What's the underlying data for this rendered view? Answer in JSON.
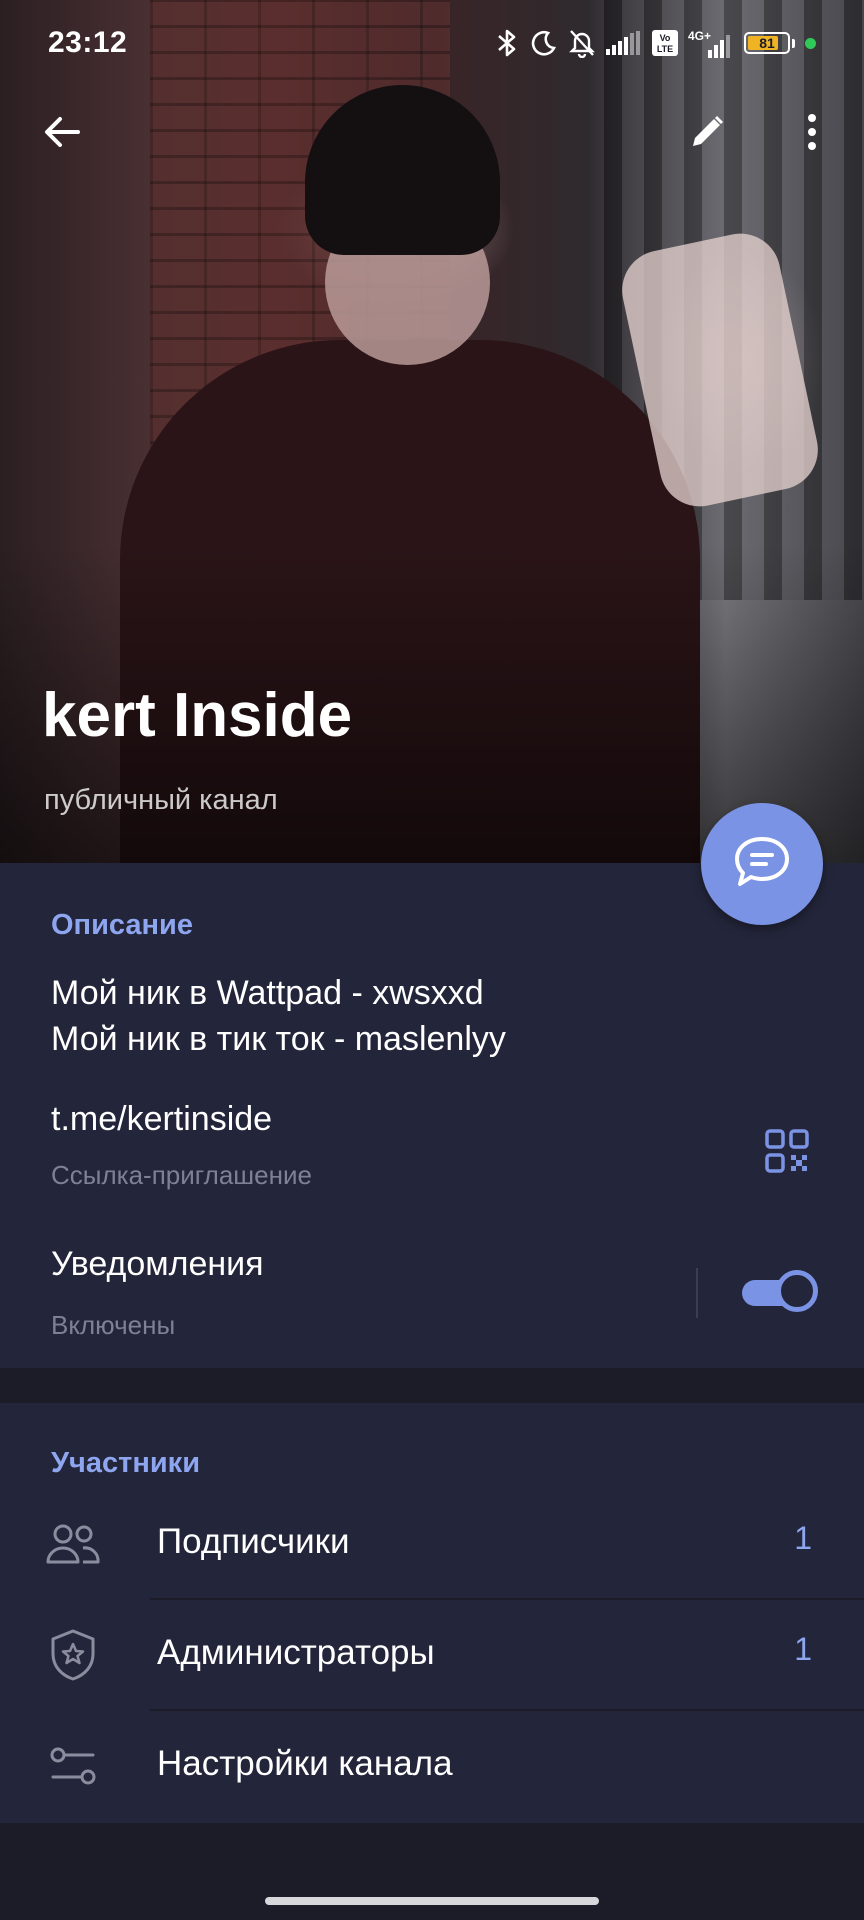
{
  "status_bar": {
    "time": "23:12",
    "battery": "81",
    "battery_level": 0.81,
    "network": "4G+",
    "volte": "Vo LTE",
    "icons": [
      "bluetooth-icon",
      "moon-icon",
      "bell-off-icon",
      "signal-icon",
      "volte-icon",
      "signal-4g-icon",
      "battery-icon",
      "green-dot-icon"
    ]
  },
  "app_bar": {
    "icons": [
      "back-arrow-icon",
      "pencil-icon",
      "more-vertical-icon"
    ]
  },
  "channel": {
    "title": "kert Inside",
    "subtitle": "публичный канал"
  },
  "info": {
    "description_label": "Описание",
    "description_lines": [
      "Мой ник в Wattpad - xwsxxd",
      "Мой ник в тик ток - maslenlyy"
    ],
    "link": "t.me/kertinside",
    "link_caption": "Ссылка-приглашение",
    "notifications_title": "Уведомления",
    "notifications_status": "Включены",
    "notifications_enabled": true
  },
  "members": {
    "label": "Участники",
    "rows": [
      {
        "label": "Подписчики",
        "count": "1",
        "icon": "users-icon"
      },
      {
        "label": "Администраторы",
        "count": "1",
        "icon": "shield-star-icon"
      },
      {
        "label": "Настройки канала",
        "count": "",
        "icon": "sliders-icon"
      }
    ]
  },
  "colors": {
    "accent": "#7b93e4",
    "section_label": "#8ea6f0",
    "panel_bg": "#23253a",
    "page_bg": "#1b1c28",
    "battery": "#f0b323",
    "status_dot": "#31c85a"
  }
}
